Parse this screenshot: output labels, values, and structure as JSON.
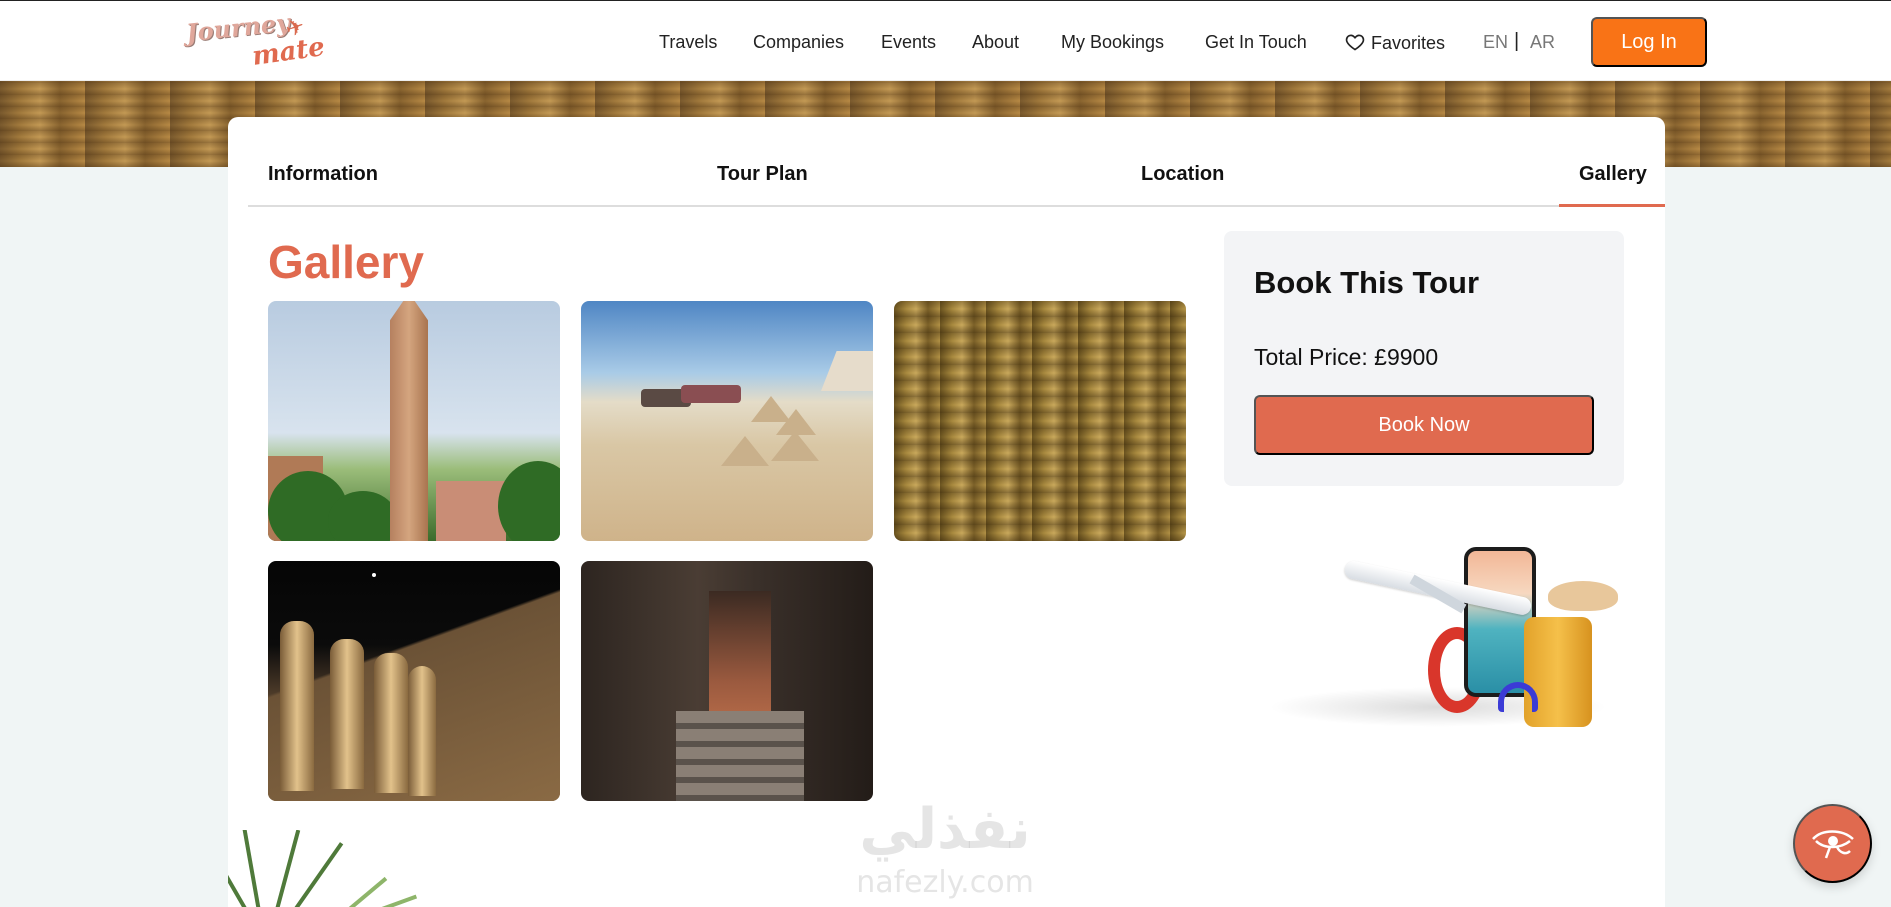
{
  "header": {
    "logo": {
      "line1": "Journey",
      "line2": "mate"
    },
    "nav": [
      {
        "label": "Travels"
      },
      {
        "label": "Companies"
      },
      {
        "label": "Events"
      },
      {
        "label": "About"
      },
      {
        "label": "My Bookings"
      },
      {
        "label": "Get In Touch"
      },
      {
        "label": "Favorites"
      }
    ],
    "lang": {
      "en": "EN",
      "separator": "|",
      "ar": "AR"
    },
    "login_label": "Log In"
  },
  "tabs": [
    {
      "label": "Information"
    },
    {
      "label": "Tour Plan"
    },
    {
      "label": "Location"
    },
    {
      "label": "Gallery",
      "active": true
    }
  ],
  "gallery": {
    "title": "Gallery",
    "images": [
      {
        "subject": "obelisk"
      },
      {
        "subject": "desert camp"
      },
      {
        "subject": "hieroglyphs"
      },
      {
        "subject": "temple columns at night"
      },
      {
        "subject": "temple corridor"
      }
    ]
  },
  "booking": {
    "title": "Book This Tour",
    "price_label": "Total Price: £9900",
    "button_label": "Book Now"
  },
  "watermark": {
    "arabic": "نفذلي",
    "latin": "nafezly.com"
  },
  "colors": {
    "accent": "#e06a4f",
    "login": "#f97316"
  },
  "icons": {
    "favorites": "heart-icon",
    "fab": "eye-of-horus-icon"
  }
}
